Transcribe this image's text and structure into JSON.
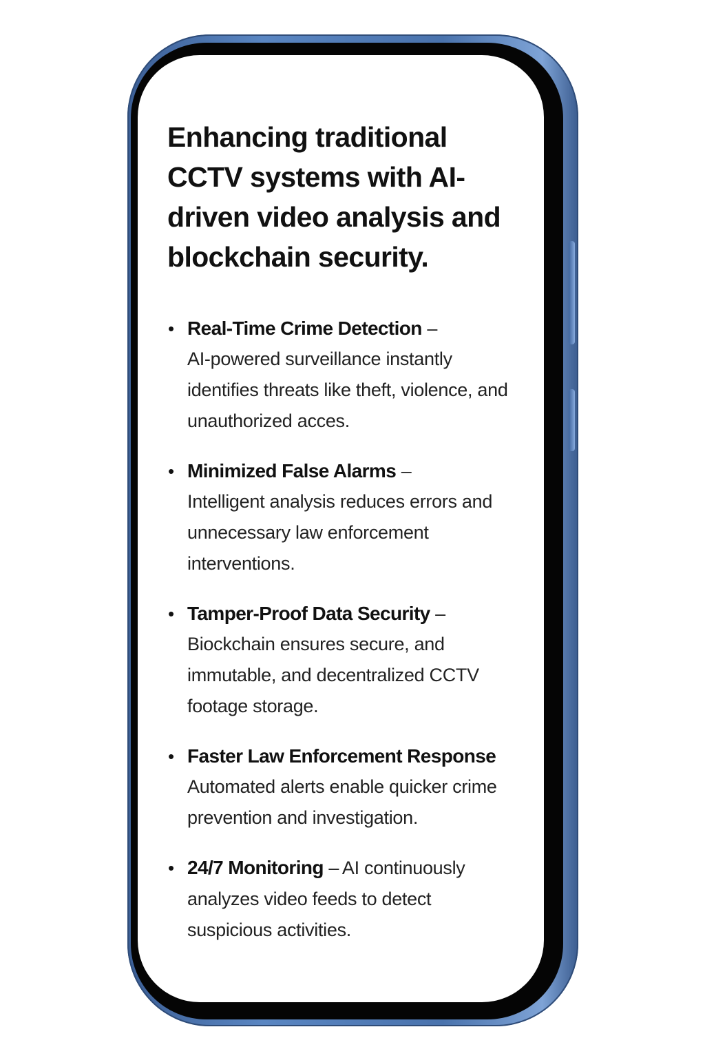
{
  "title": "Enhancing traditional CCTV systems with AI-driven video analysis and blockchain security.",
  "items": [
    {
      "heading": "Real-Time Crime Detection",
      "separator": " –",
      "body": "AI-powered surveillance instantly identifies threats like theft, violence, and unauthorized acces."
    },
    {
      "heading": "Minimized False Alarms",
      "separator": " –",
      "body": "Intelligent analysis reduces errors and unnecessary law enforcement interventions."
    },
    {
      "heading": "Tamper-Proof Data Security",
      "separator": " –",
      "body": "Biockchain ensures secure, and immutable, and decentralized CCTV footage storage."
    },
    {
      "heading": "Faster Law Enforcement Response",
      "separator": "",
      "body": "Automated alerts enable quicker crime prevention and investigation."
    },
    {
      "heading": "24/7 Monitoring",
      "separator": " –",
      "body": "AI continuously analyzes video feeds to detect suspicious activities."
    }
  ],
  "bullet": "•",
  "colors": {
    "frame": "#4a73ad",
    "bezel": "#050505",
    "screen": "#ffffff",
    "text": "#111111"
  }
}
